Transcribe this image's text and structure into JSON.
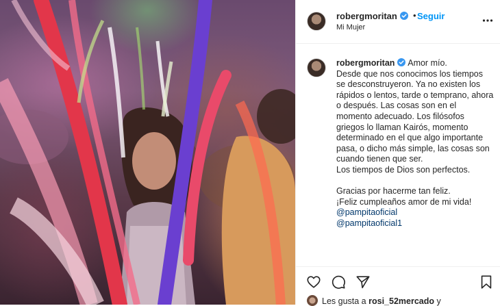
{
  "post": {
    "username": "robergmoritan",
    "verified": true,
    "follow_label": "Seguir",
    "separator": "•",
    "location": "Mi Mujer"
  },
  "caption": {
    "username": "robergmoritan",
    "lines": [
      "Amor mío.",
      "Desde que nos conocimos los tiempos se desconstruyeron. Ya no existen los rápidos o lentos, tarde o temprano, ahora o después. Las cosas son en el momento adecuado. Los filósofos griegos lo llaman Kairós, momento determinado en el que algo importante pasa, o dicho más simple, las cosas son cuando tienen que ser.",
      "Los tiempos de Dios son perfectos.",
      "",
      "Gracias por hacerme tan feliz.",
      "¡Feliz cumpleaños amor de mi vida!",
      ""
    ],
    "mentions": [
      "@pampitaoficial",
      "@pampitaoficial1"
    ]
  },
  "likes": {
    "prefix": "Les gusta a",
    "user": "rosi_52mercado",
    "suffix": "y"
  },
  "icons": {
    "more": "more-options-icon",
    "like": "heart-icon",
    "comment": "comment-icon",
    "share": "share-icon",
    "save": "bookmark-icon",
    "verified": "verified-badge-icon"
  },
  "colors": {
    "link": "#0095f6",
    "verified": "#3897f0",
    "mention": "#00376b",
    "text": "#262626"
  }
}
